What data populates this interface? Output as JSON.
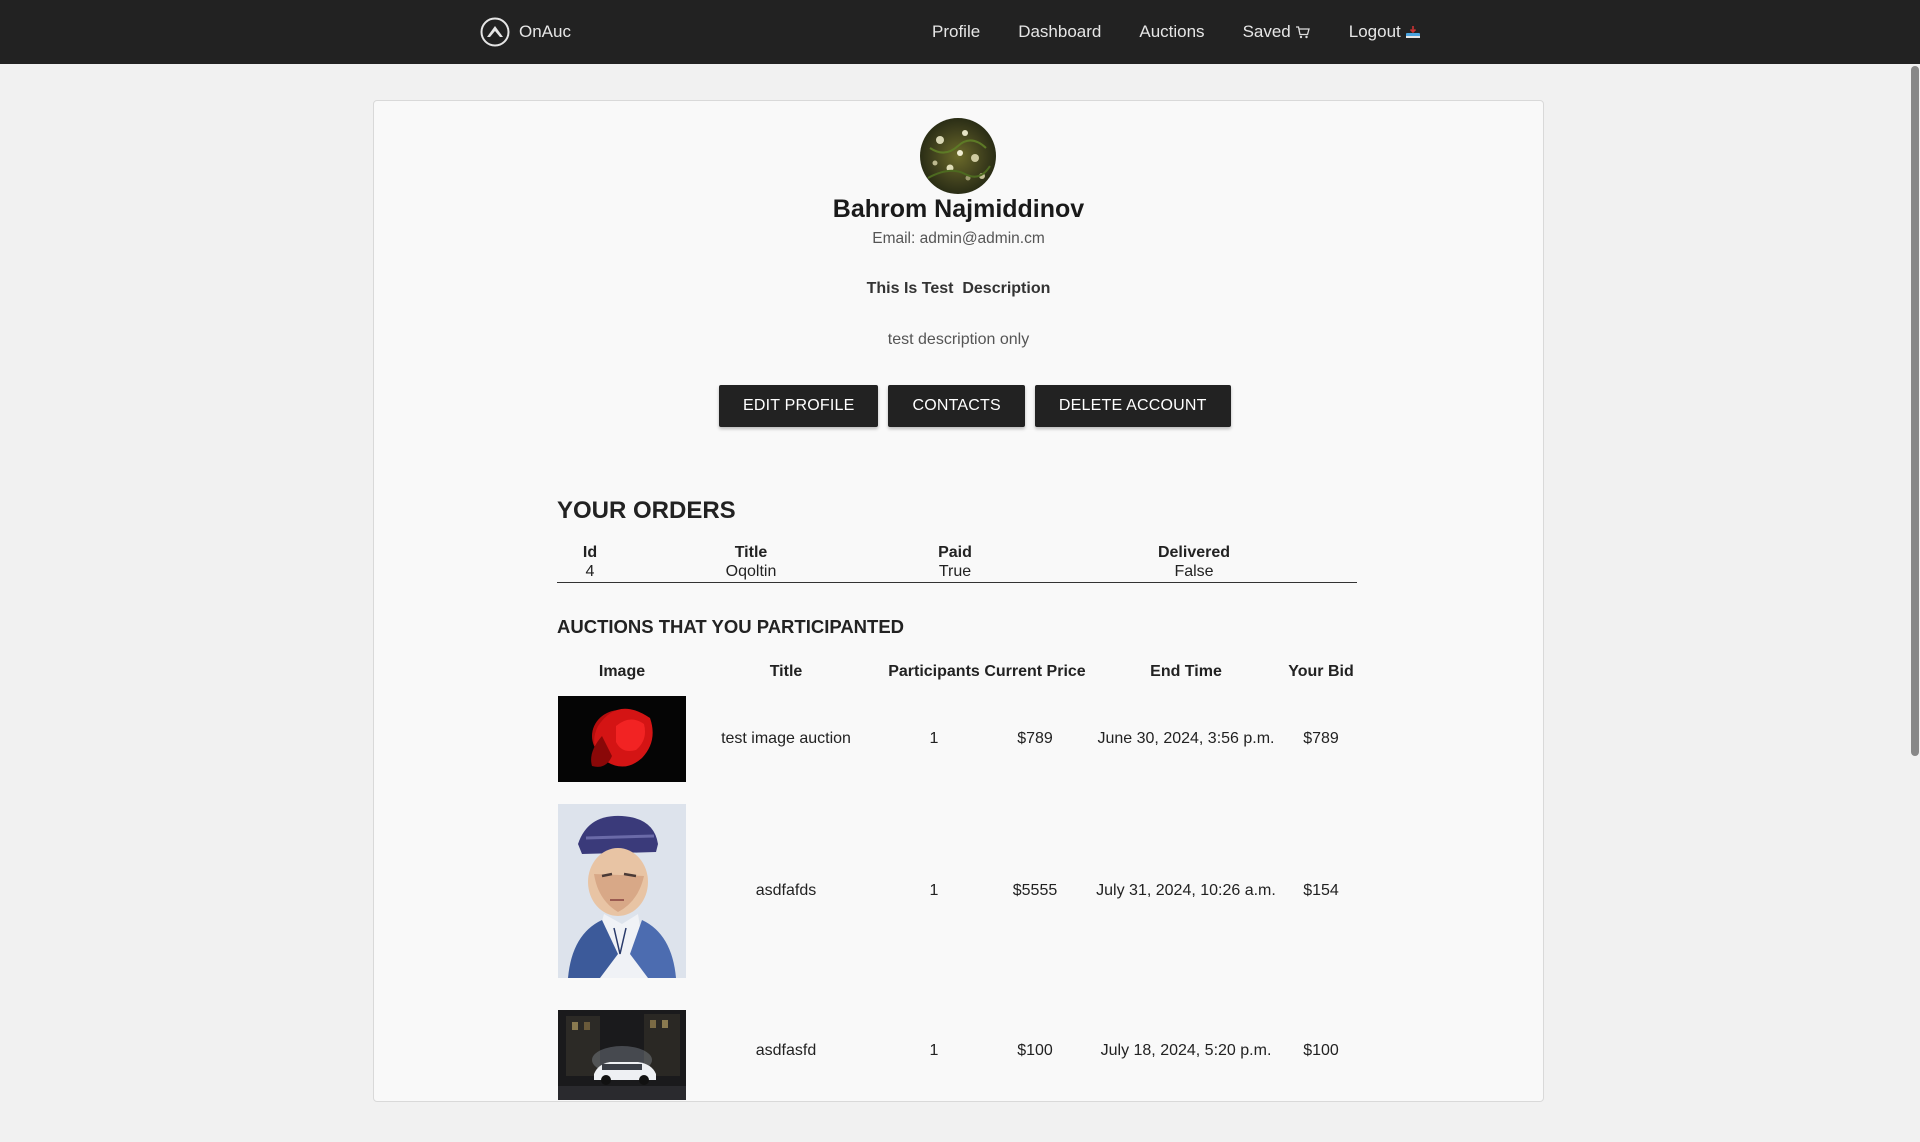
{
  "nav": {
    "brand": "OnAuc",
    "links": [
      {
        "label": "Profile"
      },
      {
        "label": "Dashboard"
      },
      {
        "label": "Auctions"
      },
      {
        "label": "Saved",
        "icon": "cart-icon"
      },
      {
        "label": "Logout",
        "icon": "logout-icon"
      }
    ]
  },
  "profile": {
    "name": "Bahrom Najmiddinov",
    "email": "Email: admin@admin.cm",
    "description_title": "This Is Test  Description",
    "description_text": "test description only",
    "buttons": {
      "edit": "EDIT PROFILE",
      "contacts": "CONTACTS",
      "delete": "DELETE ACCOUNT"
    }
  },
  "orders": {
    "title": "YOUR ORDERS",
    "headers": [
      "Id",
      "Title",
      "Paid",
      "Delivered"
    ],
    "rows": [
      [
        "4",
        "Oqoltin",
        "True",
        "False"
      ]
    ]
  },
  "auctions": {
    "title": "AUCTIONS THAT YOU PARTICIPANTED",
    "headers": [
      "Image",
      "Title",
      "Participants",
      "Current Price",
      "End Time",
      "Your Bid"
    ],
    "rows": [
      {
        "image": "red fish photo",
        "title": "test image auction",
        "participants": "1",
        "price": "$789",
        "end_time": "June 30, 2024, 3:56 p.m.",
        "bid": "$789"
      },
      {
        "image": "watercolor portrait",
        "title": "asdfafds",
        "participants": "1",
        "price": "$5555",
        "end_time": "July 31, 2024, 10:26 a.m.",
        "bid": "$154"
      },
      {
        "image": "white car at night",
        "title": "asdfasfd",
        "participants": "1",
        "price": "$100",
        "end_time": "July 18, 2024, 5:20 p.m.",
        "bid": "$100"
      }
    ]
  },
  "colors": {
    "navbar": "#222222",
    "button": "#222222",
    "page_bg": "#f1f1f1",
    "card_bg": "#f9f9f9"
  }
}
